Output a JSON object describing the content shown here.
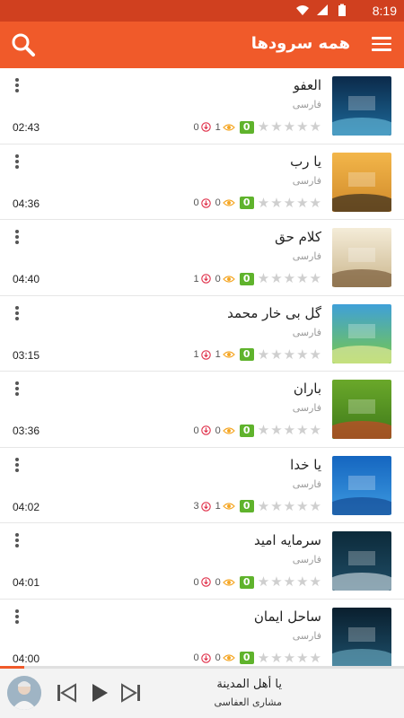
{
  "status_bar": {
    "time": "8:19"
  },
  "app_bar": {
    "title": "همه سرودها"
  },
  "colors": {
    "accent": "#f05a2a",
    "status": "#d0401f",
    "rating_badge": "#5fb32c",
    "download": "#e0304a",
    "eye": "#f5a623"
  },
  "songs": [
    {
      "title": "العفو",
      "lang": "فارسی",
      "duration": "02:43",
      "rating": "0",
      "views": "1",
      "downloads": "0",
      "thumb_title": "نشید عربی العفو",
      "thumb_sub": "حمید شاه"
    },
    {
      "title": "یا رب",
      "lang": "فارسی",
      "duration": "04:36",
      "rating": "0",
      "views": "0",
      "downloads": "0",
      "thumb_title": "نشید : یا رب",
      "thumb_sub": ""
    },
    {
      "title": "کلام حق",
      "lang": "فارسی",
      "duration": "04:40",
      "rating": "0",
      "views": "0",
      "downloads": "1",
      "thumb_title": "نشید : کلام حق",
      "thumb_sub": ""
    },
    {
      "title": "گل بی خار محمد",
      "lang": "فارسی",
      "duration": "03:15",
      "rating": "0",
      "views": "1",
      "downloads": "1",
      "thumb_title": "گل بی خار محمد",
      "thumb_sub": ""
    },
    {
      "title": "باران",
      "lang": "فارسی",
      "duration": "03:36",
      "rating": "0",
      "views": "0",
      "downloads": "0",
      "thumb_title": "باران",
      "thumb_sub": ""
    },
    {
      "title": "یا خدا",
      "lang": "فارسی",
      "duration": "04:02",
      "rating": "0",
      "views": "1",
      "downloads": "3",
      "thumb_title": "یا خدا",
      "thumb_sub": ""
    },
    {
      "title": "سرمایه امید",
      "lang": "فارسی",
      "duration": "04:01",
      "rating": "0",
      "views": "0",
      "downloads": "0",
      "thumb_title": "سرمایه امید",
      "thumb_sub": ""
    },
    {
      "title": "ساحل ایمان",
      "lang": "فارسی",
      "duration": "04:00",
      "rating": "0",
      "views": "0",
      "downloads": "0",
      "thumb_title": "ساحل ایمان",
      "thumb_sub": ""
    }
  ],
  "player": {
    "title": "يا أهل المدينة",
    "artist": "مشاری العفاسی",
    "progress": 0.06
  }
}
